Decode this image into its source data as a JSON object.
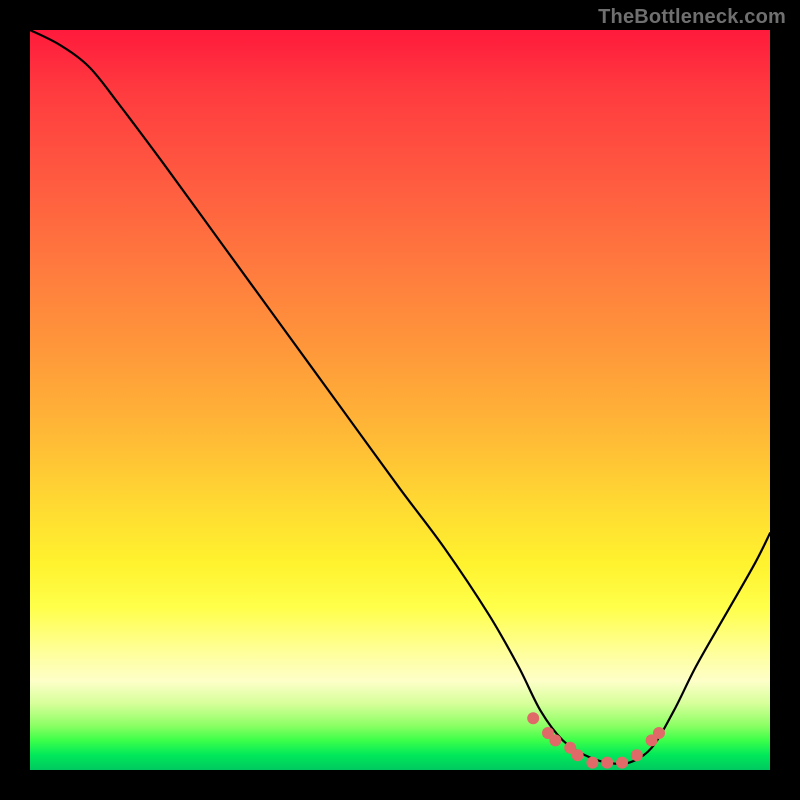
{
  "watermark": "TheBottleneck.com",
  "colors": {
    "frame": "#000000",
    "gradient_top": "#ff1a3c",
    "gradient_bottom": "#00c860",
    "curve": "#000000",
    "dots": "#e06a68"
  },
  "chart_data": {
    "type": "line",
    "title": "",
    "xlabel": "",
    "ylabel": "",
    "xlim": [
      0,
      100
    ],
    "ylim": [
      0,
      100
    ],
    "note": "No axes/ticks/legend shown. Background is a vertical red→green gradient. Curve is bottleneck-percentage style: high on left, descends to ~0 around x≈70–82, then rises toward right. Salmon dots mark points near the minimum.",
    "series": [
      {
        "name": "bottleneck-curve",
        "x": [
          0,
          4,
          8,
          12,
          18,
          26,
          34,
          42,
          50,
          56,
          62,
          66,
          69,
          72,
          75,
          78,
          81,
          84,
          87,
          90,
          94,
          98,
          100
        ],
        "y": [
          100,
          98,
          95,
          90,
          82,
          71,
          60,
          49,
          38,
          30,
          21,
          14,
          8,
          4,
          2,
          1,
          1,
          3,
          8,
          14,
          21,
          28,
          32
        ]
      }
    ],
    "highlight_points": {
      "name": "near-minimum-dots",
      "x": [
        68,
        70,
        71,
        73,
        74,
        76,
        78,
        80,
        82,
        84,
        85
      ],
      "y": [
        7,
        5,
        4,
        3,
        2,
        1,
        1,
        1,
        2,
        4,
        5
      ]
    }
  }
}
